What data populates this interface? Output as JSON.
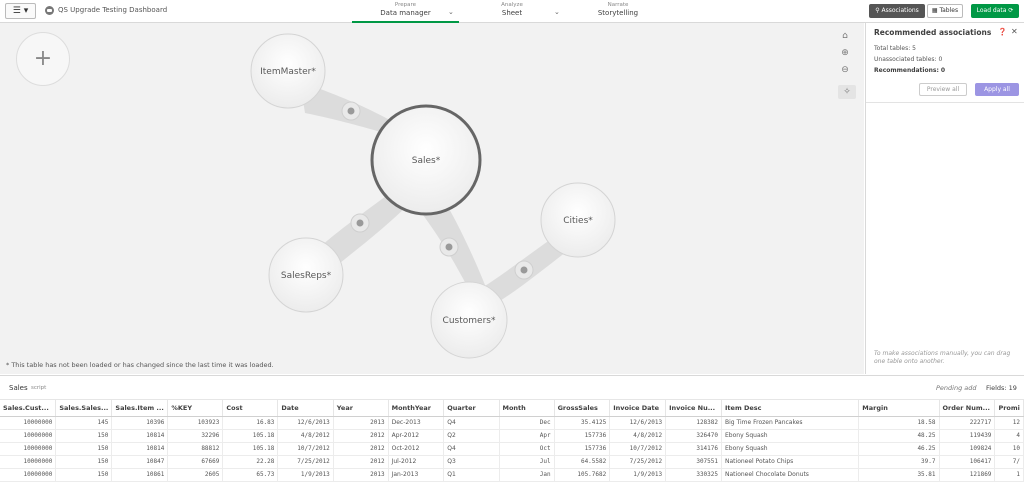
{
  "topbar": {
    "menu_label": "☰ ▾",
    "app_title": "QS Upgrade Testing Dashboard",
    "steps": [
      {
        "sub": "Prepare",
        "main": "Data manager"
      },
      {
        "sub": "Analyze",
        "main": "Sheet"
      },
      {
        "sub": "Narrate",
        "main": "Storytelling"
      }
    ],
    "associations_label": "Associations",
    "tables_label": "Tables",
    "load_label": "Load data"
  },
  "canvas": {
    "add_label": "+",
    "tables": {
      "itemmaster": "ItemMaster*",
      "sales": "Sales*",
      "salesreps": "SalesReps*",
      "cities": "Cities*",
      "customers": "Customers*"
    },
    "footnote": "* This table has not been loaded or has changed since the last time it was loaded."
  },
  "panel": {
    "title": "Recommended associations",
    "total_tables": "Total tables: 5",
    "unassociated": "Unassociated tables: 0",
    "recommendations": "Recommendations: 0",
    "preview_all": "Preview all",
    "apply_all": "Apply all",
    "hint": "To make associations manually, you can drag one table onto another."
  },
  "preview": {
    "tab": "Sales",
    "tab_sub": "script",
    "pending": "Pending add",
    "fields": "Fields: 19"
  },
  "table": {
    "columns": [
      "Sales.Cust...",
      "Sales.Sales...",
      "Sales.Item ...",
      "%KEY",
      "Cost",
      "Date",
      "Year",
      "MonthYear",
      "Quarter",
      "Month",
      "GrossSales",
      "Invoice Date",
      "Invoice Nu...",
      "Item Desc",
      "Margin",
      "Order Num...",
      "Promi"
    ],
    "rows": [
      [
        "10000000",
        "145",
        "10396",
        "103923",
        "16.83",
        "12/6/2013",
        "2013",
        "Dec-2013",
        "Q4",
        "Dec",
        "35.4125",
        "12/6/2013",
        "128382",
        "Big Time Frozen Pancakes",
        "18.58",
        "222717",
        "12"
      ],
      [
        "10000000",
        "150",
        "10814",
        "32296",
        "105.18",
        "4/8/2012",
        "2012",
        "Apr-2012",
        "Q2",
        "Apr",
        "157736",
        "4/8/2012",
        "326470",
        "Ebony Squash",
        "48.25",
        "119439",
        "4"
      ],
      [
        "10000000",
        "150",
        "10814",
        "88812",
        "105.18",
        "10/7/2012",
        "2012",
        "Oct-2012",
        "Q4",
        "Oct",
        "157736",
        "10/7/2012",
        "314176",
        "Ebony Squash",
        "46.25",
        "109824",
        "10"
      ],
      [
        "10000000",
        "150",
        "10847",
        "67669",
        "22.28",
        "7/25/2012",
        "2012",
        "Jul-2012",
        "Q3",
        "Jul",
        "64.5582",
        "7/25/2012",
        "307551",
        "Nationeel Potato Chips",
        "39.7",
        "106417",
        "7/"
      ],
      [
        "10000000",
        "150",
        "10861",
        "2605",
        "65.73",
        "1/9/2013",
        "2013",
        "Jan-2013",
        "Q1",
        "Jan",
        "105.7682",
        "1/9/2013",
        "330325",
        "Nationeel Chocolate Donuts",
        "35.81",
        "121869",
        "1"
      ]
    ]
  },
  "colors": {
    "accent_green": "#009845",
    "apply_purple": "#9c95e3",
    "canvas_bg": "#f2f2f2"
  }
}
